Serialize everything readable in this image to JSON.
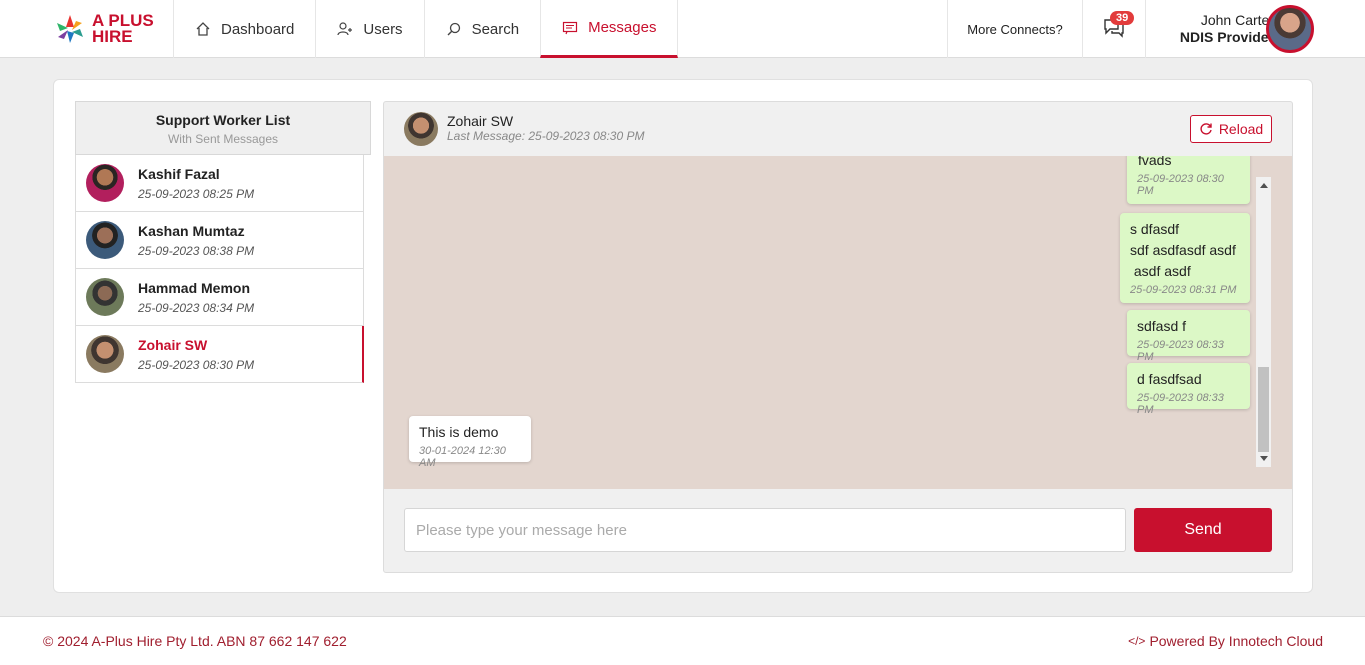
{
  "brand": {
    "logo_line1": "A PLUS",
    "logo_line2": "HIRE",
    "accent": "#c8102e"
  },
  "nav": {
    "items": [
      {
        "label": "Dashboard",
        "icon": "home-icon"
      },
      {
        "label": "Users",
        "icon": "users-icon"
      },
      {
        "label": "Search",
        "icon": "search-icon"
      },
      {
        "label": "Messages",
        "icon": "message-icon",
        "active": true
      }
    ],
    "more_connects": "More Connects?",
    "notification_count": "39",
    "user_name": "John Carter",
    "user_role": "NDIS Provider"
  },
  "sidebar": {
    "title": "Support Worker List",
    "subtitle": "With Sent Messages",
    "contacts": [
      {
        "name": "Kashif Fazal",
        "time": "25-09-2023 08:25 PM"
      },
      {
        "name": "Kashan Mumtaz",
        "time": "25-09-2023 08:38 PM"
      },
      {
        "name": "Hammad Memon",
        "time": "25-09-2023 08:34 PM"
      },
      {
        "name": "Zohair SW",
        "time": "25-09-2023 08:30 PM",
        "active": true
      }
    ]
  },
  "chat": {
    "name": "Zohair SW",
    "last_message": "Last Message: 25-09-2023 08:30 PM",
    "reload_label": "Reload",
    "messages": [
      {
        "direction": "out",
        "text": "fvads",
        "time": "25-09-2023 08:30 PM"
      },
      {
        "direction": "out",
        "lines": [
          "s dfasdf",
          "sdf asdfasdf asdf",
          " asdf asdf"
        ],
        "time": "25-09-2023 08:31 PM"
      },
      {
        "direction": "out",
        "text": "sdfasd f",
        "time": "25-09-2023 08:33 PM"
      },
      {
        "direction": "out",
        "text": "d fasdfsad",
        "time": "25-09-2023 08:33 PM"
      },
      {
        "direction": "in",
        "text": "This is demo",
        "time": "30-01-2024 12:30 AM"
      }
    ],
    "input_placeholder": "Please type your message here",
    "input_value": "",
    "send_label": "Send"
  },
  "footer": {
    "copyright": "© 2024 A-Plus Hire Pty Ltd. ABN 87 662 147 622",
    "powered": "Powered By Innotech Cloud",
    "powered_icon": "code-icon"
  }
}
